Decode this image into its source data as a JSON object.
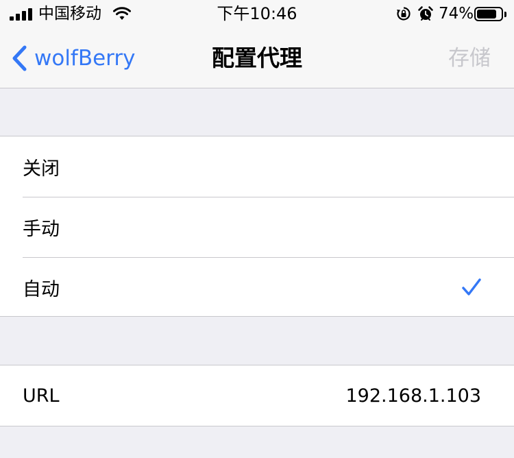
{
  "status_bar": {
    "carrier": "中国移动",
    "time": "下午10:46",
    "battery_percent": "74%"
  },
  "nav": {
    "back_label": "wolfBerry",
    "title": "配置代理",
    "save_label": "存储"
  },
  "proxy_modes": [
    {
      "label": "关闭",
      "selected": false
    },
    {
      "label": "手动",
      "selected": false
    },
    {
      "label": "自动",
      "selected": true
    }
  ],
  "url_field": {
    "label": "URL",
    "value": "192.168.1.103"
  },
  "colors": {
    "accent": "#3478f6",
    "disabled": "#c7c7cc",
    "background": "#efeff4",
    "separator": "#c8c7cc"
  },
  "icons": [
    "signal-icon",
    "wifi-icon",
    "rotation-lock-icon",
    "alarm-icon",
    "battery-icon",
    "back-chevron-icon",
    "checkmark-icon"
  ]
}
